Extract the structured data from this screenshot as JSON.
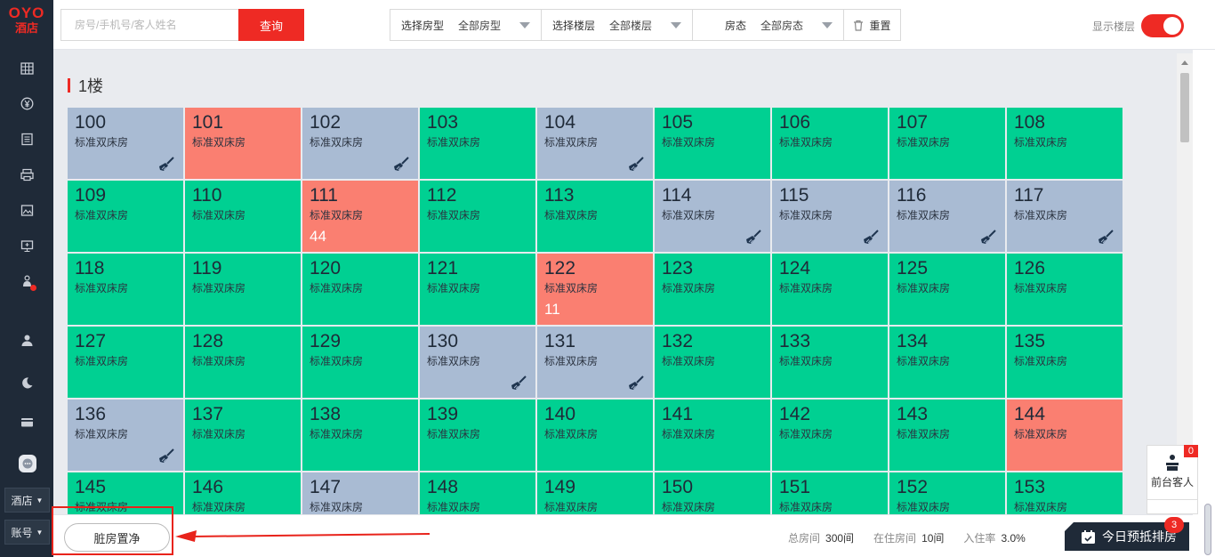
{
  "sidebar": {
    "logo_top": "OYO",
    "logo_bottom": "酒店",
    "hotel_menu": "酒店",
    "account_menu": "账号",
    "icons": [
      "calendar-grid-icon",
      "yuan-icon",
      "list-icon",
      "printer-icon",
      "image-icon",
      "monitor-icon",
      "bell-icon",
      "user-icon",
      "moon-icon",
      "card-icon"
    ]
  },
  "search": {
    "placeholder": "房号/手机号/客人姓名",
    "button": "查询"
  },
  "filters": [
    {
      "label": "选择房型",
      "value": "全部房型"
    },
    {
      "label": "选择楼层",
      "value": "全部楼层"
    },
    {
      "label": "房态",
      "value": "全部房态"
    }
  ],
  "reset": "重置",
  "show_floor_label": "显示楼层",
  "show_floor_on": true,
  "floor_title": "1楼",
  "rooms": [
    {
      "num": "100",
      "type": "标准双床房",
      "status": "dirty",
      "count": ""
    },
    {
      "num": "101",
      "type": "标准双床房",
      "status": "occupied",
      "count": ""
    },
    {
      "num": "102",
      "type": "标准双床房",
      "status": "dirty",
      "count": ""
    },
    {
      "num": "103",
      "type": "标准双床房",
      "status": "vacant",
      "count": ""
    },
    {
      "num": "104",
      "type": "标准双床房",
      "status": "dirty",
      "count": ""
    },
    {
      "num": "105",
      "type": "标准双床房",
      "status": "vacant",
      "count": ""
    },
    {
      "num": "106",
      "type": "标准双床房",
      "status": "vacant",
      "count": ""
    },
    {
      "num": "107",
      "type": "标准双床房",
      "status": "vacant",
      "count": ""
    },
    {
      "num": "108",
      "type": "标准双床房",
      "status": "vacant",
      "count": ""
    },
    {
      "num": "109",
      "type": "标准双床房",
      "status": "vacant",
      "count": ""
    },
    {
      "num": "110",
      "type": "标准双床房",
      "status": "vacant",
      "count": ""
    },
    {
      "num": "111",
      "type": "标准双床房",
      "status": "occupied",
      "count": "44"
    },
    {
      "num": "112",
      "type": "标准双床房",
      "status": "vacant",
      "count": ""
    },
    {
      "num": "113",
      "type": "标准双床房",
      "status": "vacant",
      "count": ""
    },
    {
      "num": "114",
      "type": "标准双床房",
      "status": "dirty",
      "count": ""
    },
    {
      "num": "115",
      "type": "标准双床房",
      "status": "dirty",
      "count": ""
    },
    {
      "num": "116",
      "type": "标准双床房",
      "status": "dirty",
      "count": ""
    },
    {
      "num": "117",
      "type": "标准双床房",
      "status": "dirty",
      "count": ""
    },
    {
      "num": "118",
      "type": "标准双床房",
      "status": "vacant",
      "count": ""
    },
    {
      "num": "119",
      "type": "标准双床房",
      "status": "vacant",
      "count": ""
    },
    {
      "num": "120",
      "type": "标准双床房",
      "status": "vacant",
      "count": ""
    },
    {
      "num": "121",
      "type": "标准双床房",
      "status": "vacant",
      "count": ""
    },
    {
      "num": "122",
      "type": "标准双床房",
      "status": "occupied",
      "count": "11"
    },
    {
      "num": "123",
      "type": "标准双床房",
      "status": "vacant",
      "count": ""
    },
    {
      "num": "124",
      "type": "标准双床房",
      "status": "vacant",
      "count": ""
    },
    {
      "num": "125",
      "type": "标准双床房",
      "status": "vacant",
      "count": ""
    },
    {
      "num": "126",
      "type": "标准双床房",
      "status": "vacant",
      "count": ""
    },
    {
      "num": "127",
      "type": "标准双床房",
      "status": "vacant",
      "count": ""
    },
    {
      "num": "128",
      "type": "标准双床房",
      "status": "vacant",
      "count": ""
    },
    {
      "num": "129",
      "type": "标准双床房",
      "status": "vacant",
      "count": ""
    },
    {
      "num": "130",
      "type": "标准双床房",
      "status": "dirty",
      "count": ""
    },
    {
      "num": "131",
      "type": "标准双床房",
      "status": "dirty",
      "count": ""
    },
    {
      "num": "132",
      "type": "标准双床房",
      "status": "vacant",
      "count": ""
    },
    {
      "num": "133",
      "type": "标准双床房",
      "status": "vacant",
      "count": ""
    },
    {
      "num": "134",
      "type": "标准双床房",
      "status": "vacant",
      "count": ""
    },
    {
      "num": "135",
      "type": "标准双床房",
      "status": "vacant",
      "count": ""
    },
    {
      "num": "136",
      "type": "标准双床房",
      "status": "dirty",
      "count": ""
    },
    {
      "num": "137",
      "type": "标准双床房",
      "status": "vacant",
      "count": ""
    },
    {
      "num": "138",
      "type": "标准双床房",
      "status": "vacant",
      "count": ""
    },
    {
      "num": "139",
      "type": "标准双床房",
      "status": "vacant",
      "count": ""
    },
    {
      "num": "140",
      "type": "标准双床房",
      "status": "vacant",
      "count": ""
    },
    {
      "num": "141",
      "type": "标准双床房",
      "status": "vacant",
      "count": ""
    },
    {
      "num": "142",
      "type": "标准双床房",
      "status": "vacant",
      "count": ""
    },
    {
      "num": "143",
      "type": "标准双床房",
      "status": "vacant",
      "count": ""
    },
    {
      "num": "144",
      "type": "标准双床房",
      "status": "occupied",
      "count": ""
    },
    {
      "num": "145",
      "type": "标准双床房",
      "status": "vacant",
      "count": ""
    },
    {
      "num": "146",
      "type": "标准双床房",
      "status": "vacant",
      "count": ""
    },
    {
      "num": "147",
      "type": "标准双床房",
      "status": "dirty",
      "count": ""
    },
    {
      "num": "148",
      "type": "标准双床房",
      "status": "vacant",
      "count": ""
    },
    {
      "num": "149",
      "type": "标准双床房",
      "status": "vacant",
      "count": ""
    },
    {
      "num": "150",
      "type": "标准双床房",
      "status": "vacant",
      "count": ""
    },
    {
      "num": "151",
      "type": "标准双床房",
      "status": "vacant",
      "count": ""
    },
    {
      "num": "152",
      "type": "标准双床房",
      "status": "vacant",
      "count": ""
    },
    {
      "num": "153",
      "type": "标准双床房",
      "status": "vacant",
      "count": ""
    }
  ],
  "colors": {
    "vacant": "#00d092",
    "occupied": "#fa7f71",
    "dirty": "#a9bbd3",
    "brand": "#ee2a24",
    "dark": "#1f2a38"
  },
  "front_desk": {
    "label": "前台客人",
    "badge": "0"
  },
  "bottom": {
    "dirty_clean_button": "脏房置净",
    "total_rooms_label": "总房间",
    "total_rooms_value": "300间",
    "occupied_label": "在住房间",
    "occupied_value": "10间",
    "occupancy_label": "入住率",
    "occupancy_value": "3.0%",
    "today_button": "今日预抵排房",
    "today_badge": "3"
  }
}
